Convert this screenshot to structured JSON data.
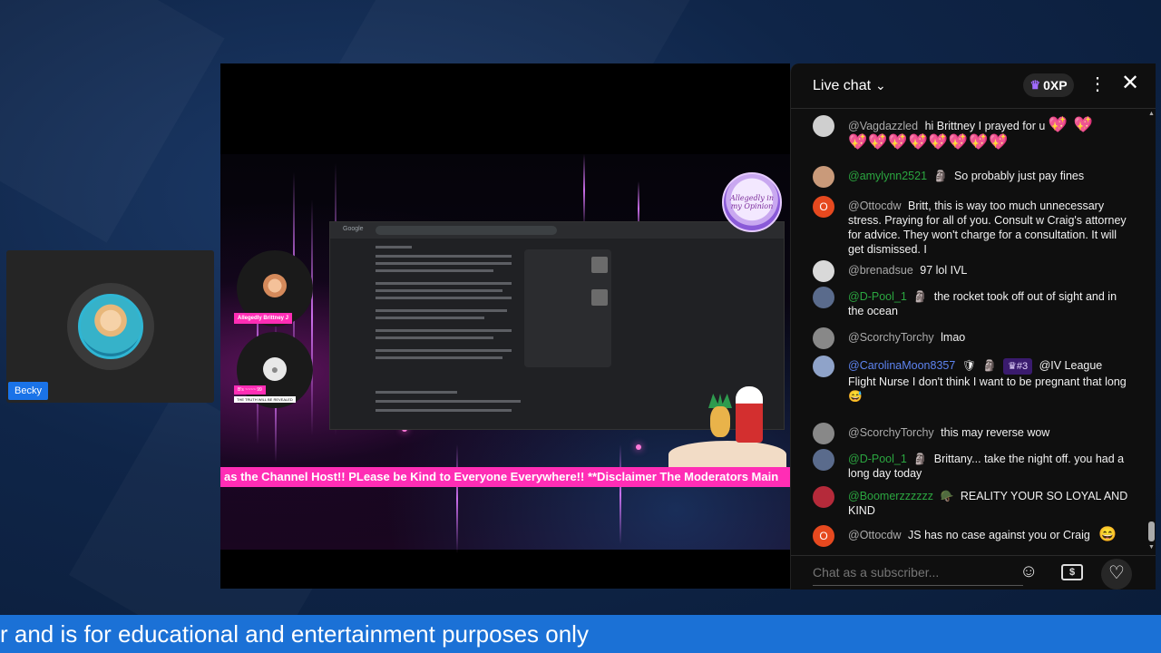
{
  "guest": {
    "name": "Becky"
  },
  "stream": {
    "host_label": "Allegedly Brittney J",
    "guest_label": "B's ~~~~ 99",
    "guest_sublabel": "THE TRUTH WILL BE REVEALED",
    "logo_text": "Allegedly in my Opinion",
    "ticker_text": "as the Channel Host!! PLease be Kind to Everyone Everywhere!! **Disclaimer The Moderators Main",
    "screen_logo": "Google"
  },
  "chat": {
    "title": "Live chat",
    "xp": "0XP",
    "input_placeholder": "Chat as a subscriber...",
    "messages": [
      {
        "user": "@Vagdazzled",
        "type": "normal",
        "text": "hi Brittney I prayed for u",
        "hearts_inline": "💖 💖",
        "hearts_line": "💖💖💖💖💖💖💖💖",
        "avatar_color": "#cfcfcf"
      },
      {
        "user": "@amylynn2521",
        "type": "member",
        "badge": "🗿",
        "text": "So probably just pay fines",
        "avatar_color": "#c99a7a"
      },
      {
        "user": "@Ottocdw",
        "type": "normal",
        "text": "Britt, this is way too much unnecessary stress. Praying for all of you. Consult w Craig's attorney for advice. They won't charge for a consultation. It will get dismissed. I",
        "avatar_color": "#e6491f",
        "avatar_letter": "O"
      },
      {
        "user": "@brenadsue",
        "type": "normal",
        "text": "97 lol IVL",
        "avatar_color": "#d9d9d9"
      },
      {
        "user": "@D-Pool_1",
        "type": "member",
        "badge": "🗿",
        "text": "the rocket took off out of sight and in the ocean",
        "avatar_color": "#5a6b8c"
      },
      {
        "user": "@ScorchyTorchy",
        "type": "normal",
        "text": "lmao",
        "avatar_color": "#888"
      },
      {
        "user": "@CarolinaMoon8357",
        "type": "mod",
        "badge": "🛡",
        "badge2": "🗿",
        "rank": "♛#3",
        "text": "@IV League Flight Nurse I don't think I want to be pregnant that long 😅",
        "avatar_color": "#8fa3c9"
      },
      {
        "user": "@ScorchyTorchy",
        "type": "normal",
        "text": "this may reverse wow",
        "avatar_color": "#888"
      },
      {
        "user": "@D-Pool_1",
        "type": "member",
        "badge": "🗿",
        "text": "Brittany... take the night off. you had a long day today",
        "avatar_color": "#5a6b8c"
      },
      {
        "user": "@Boomerzzzzzz",
        "type": "member",
        "badge": "🪖",
        "text": "REALITY YOUR SO LOYAL AND KIND",
        "avatar_color": "#b52a3a"
      },
      {
        "user": "@Ottocdw",
        "type": "normal",
        "text": "JS has no case against you or Craig",
        "trailing_emoji": "😄",
        "avatar_color": "#e6491f",
        "avatar_letter": "O"
      }
    ]
  },
  "bottom_banner": {
    "text": "r and is for educational and entertainment purposes only"
  },
  "colors": {
    "ticker": "#ff2db5",
    "banner": "#1b71d6",
    "member_name": "#2ba640",
    "mod_name": "#5e84f1"
  }
}
